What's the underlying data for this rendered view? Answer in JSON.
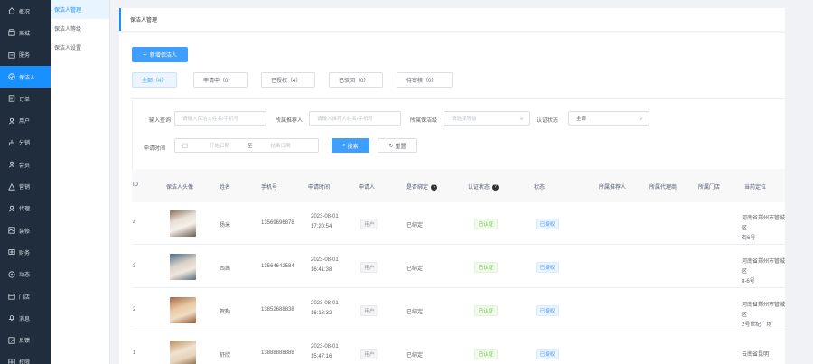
{
  "sidebar": {
    "items": [
      {
        "label": "概况",
        "icon": "home-icon"
      },
      {
        "label": "商城",
        "icon": "shop-icon"
      },
      {
        "label": "服务",
        "icon": "service-icon"
      },
      {
        "label": "保洁人",
        "icon": "cleaner-icon",
        "active": true
      },
      {
        "label": "订单",
        "icon": "order-icon"
      },
      {
        "label": "用户",
        "icon": "user-icon"
      },
      {
        "label": "分销",
        "icon": "distribution-icon"
      },
      {
        "label": "会员",
        "icon": "member-icon"
      },
      {
        "label": "营销",
        "icon": "marketing-icon"
      },
      {
        "label": "代理",
        "icon": "agent-icon"
      },
      {
        "label": "装修",
        "icon": "decoration-icon"
      },
      {
        "label": "财务",
        "icon": "finance-icon"
      },
      {
        "label": "动态",
        "icon": "news-icon"
      },
      {
        "label": "门店",
        "icon": "store-icon"
      },
      {
        "label": "消息",
        "icon": "bell-icon"
      },
      {
        "label": "反馈",
        "icon": "feedback-icon"
      },
      {
        "label": "权限",
        "icon": "permission-icon"
      }
    ]
  },
  "submenu": {
    "items": [
      {
        "label": "保洁人管理",
        "active": true
      },
      {
        "label": "保洁人等级"
      },
      {
        "label": "保洁人设置"
      }
    ]
  },
  "breadcrumb": "保洁人管理",
  "toolbar": {
    "add_label": "新增保洁人"
  },
  "tabs": [
    {
      "label": "全部（4）",
      "active": true
    },
    {
      "label": "申请中（0）"
    },
    {
      "label": "已授权（4）"
    },
    {
      "label": "已驳回（0）"
    },
    {
      "label": "待审核（0）"
    }
  ],
  "filters": {
    "search_label": "输入查询",
    "search_placeholder": "请输入保洁人姓名/手机号",
    "agent_label": "所属推荐人",
    "agent_placeholder": "请输入推荐人姓名/手机号",
    "level_label": "所属保洁级",
    "level_placeholder": "请选择等级",
    "auth_label": "认证状态",
    "auth_value": "全部",
    "date_label": "申请时间",
    "date_start_placeholder": "开始日期",
    "date_sep": "至",
    "date_end_placeholder": "结束日期",
    "search_button": "搜索",
    "reset_button": "重置"
  },
  "table": {
    "headers": [
      "ID",
      "保洁人头像",
      "姓名",
      "手机号",
      "申请时间",
      "申请人",
      "是否绑定",
      "认证状态",
      "状态",
      "所属推荐人",
      "所属代理商",
      "所属门店",
      "当前定位"
    ],
    "rows": [
      {
        "id": "4",
        "name": "杨米",
        "phone": "13569696878",
        "date": "2023-08-01",
        "time": "17:20:54",
        "applicant": "用户",
        "bound": "已绑定",
        "auth": "已认证",
        "status": "已授权",
        "location": "河南省郑州市管城区\n街6号"
      },
      {
        "id": "3",
        "name": "西茜",
        "phone": "13564642584",
        "date": "2023-08-01",
        "time": "16:41:38",
        "applicant": "用户",
        "bound": "已绑定",
        "auth": "已认证",
        "status": "已授权",
        "location": "河南省郑州市管城区\n8-6号"
      },
      {
        "id": "2",
        "name": "贺勤",
        "phone": "13852688838",
        "date": "2023-08-01",
        "time": "16:18:32",
        "applicant": "用户",
        "bound": "已绑定",
        "auth": "已认证",
        "status": "已授权",
        "location": "河南省郑州市管城区\n2号世纪广场"
      },
      {
        "id": "1",
        "name": "舒欣",
        "phone": "13888888888",
        "date": "2023-08-01",
        "time": "15:47:16",
        "applicant": "用户",
        "bound": "已绑定",
        "auth": "已认证",
        "status": "已授权",
        "location": "云南省昆明"
      }
    ]
  },
  "colors": {
    "primary": "#409eff",
    "sidebar_bg": "#1f2d3d",
    "active": "#1890ff",
    "success": "#67c23a"
  }
}
